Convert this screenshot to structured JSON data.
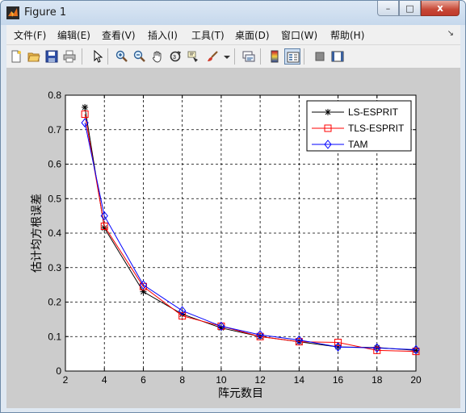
{
  "window": {
    "title": "Figure 1",
    "minimize": "–",
    "maximize": "□",
    "close": "x"
  },
  "menu": [
    "文件(F)",
    "编辑(E)",
    "查看(V)",
    "插入(I)",
    "工具(T)",
    "桌面(D)",
    "窗口(W)",
    "帮助(H)"
  ],
  "menu_arrow": "↘",
  "toolbar": [
    "new-figure",
    "open-file",
    "save",
    "print",
    "pointer",
    "zoom-in",
    "zoom-out",
    "pan",
    "rotate-3d",
    "data-cursor",
    "brush",
    "brush-dropdown",
    "link-plot",
    "insert-colorbar",
    "insert-legend",
    "hide-plot-tools",
    "show-plot-tools"
  ],
  "colors": {
    "ls": "#000000",
    "tls": "#ff0000",
    "tam": "#0000ff",
    "figure_bg": "#cccccc"
  },
  "chart_data": {
    "type": "line",
    "title": "",
    "xlabel": "阵元数目",
    "ylabel": "估计均方根误差",
    "xlim": [
      2,
      20
    ],
    "ylim": [
      0,
      0.8
    ],
    "x_ticks": [
      2,
      4,
      6,
      8,
      10,
      12,
      14,
      16,
      18,
      20
    ],
    "y_ticks": [
      0,
      0.1,
      0.2,
      0.3,
      0.4,
      0.5,
      0.6,
      0.7,
      0.8
    ],
    "x_tick_labels": [
      "2",
      "4",
      "6",
      "8",
      "10",
      "12",
      "14",
      "16",
      "18",
      "20"
    ],
    "y_tick_labels": [
      "0",
      "0.1",
      "0.2",
      "0.3",
      "0.4",
      "0.5",
      "0.6",
      "0.7",
      "0.8"
    ],
    "grid": true,
    "legend_position": "top-right",
    "x": [
      3,
      4,
      6,
      8,
      10,
      12,
      14,
      16,
      18,
      20
    ],
    "series": [
      {
        "name": "LS-ESPRIT",
        "marker": "star",
        "color": "#000000",
        "values": [
          0.765,
          0.415,
          0.23,
          0.165,
          0.125,
          0.1,
          0.085,
          0.07,
          0.068,
          0.06
        ]
      },
      {
        "name": "TLS-ESPRIT",
        "marker": "square",
        "color": "#ff0000",
        "values": [
          0.745,
          0.42,
          0.245,
          0.16,
          0.13,
          0.1,
          0.085,
          0.083,
          0.06,
          0.057
        ]
      },
      {
        "name": "TAM",
        "marker": "diamond",
        "color": "#0000ff",
        "values": [
          0.72,
          0.45,
          0.25,
          0.175,
          0.13,
          0.105,
          0.09,
          0.07,
          0.067,
          0.062
        ]
      }
    ]
  }
}
